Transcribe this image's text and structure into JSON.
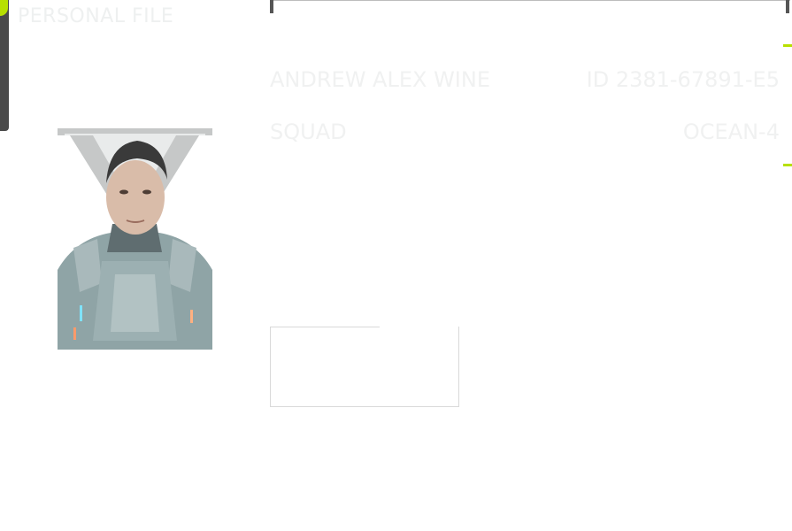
{
  "header": {
    "title": "PERSONAL FILE"
  },
  "profile": {
    "name": "ANDREW ALEX WINE",
    "id": "ID 2381-67891-E5",
    "squad_label": "SQUAD",
    "squad_value": "OCEAN-4"
  },
  "portrait": {
    "subject": "soldier-portrait"
  },
  "colors": {
    "accent": "#b7e000",
    "frame": "#bdbdbd",
    "dark": "#4a4a4a",
    "text_faint": "#f0f1f1"
  }
}
